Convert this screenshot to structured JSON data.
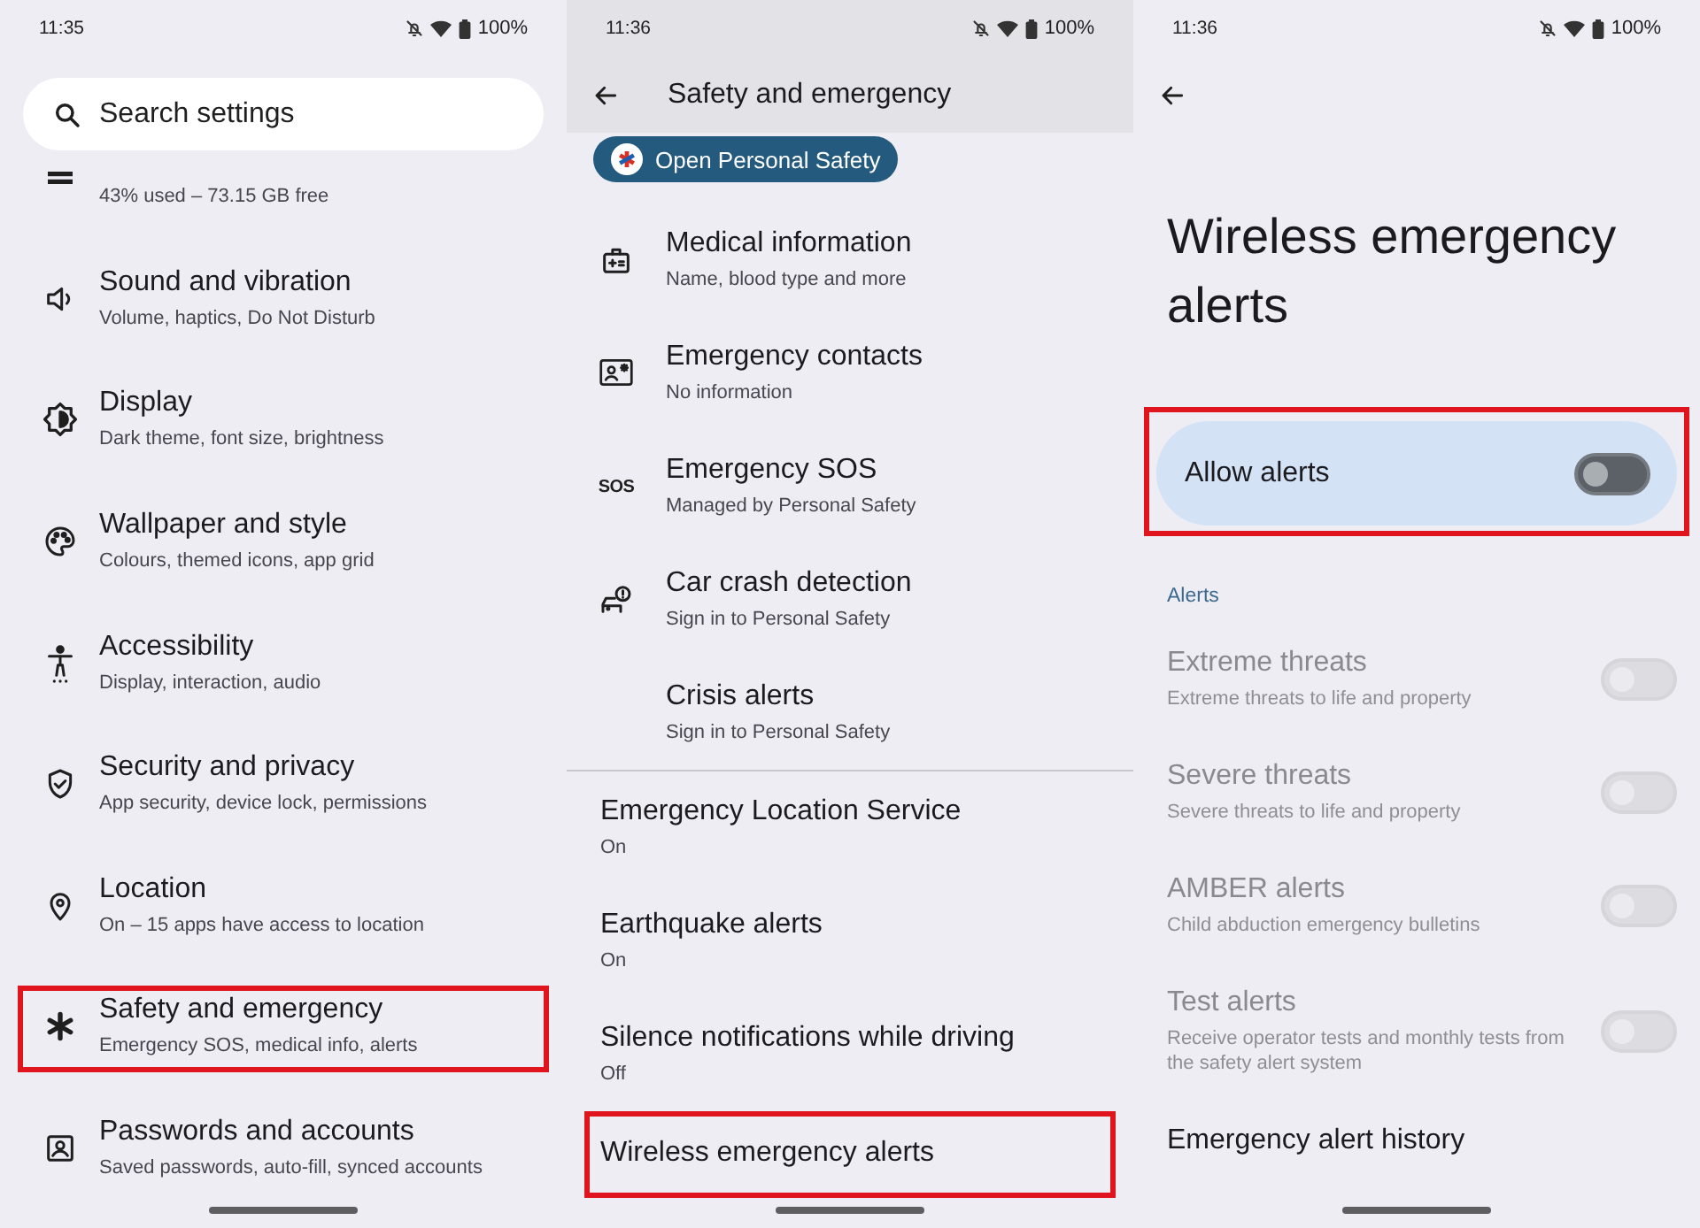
{
  "settings_screen": {
    "status_bar": {
      "time": "11:35",
      "battery": "100%"
    },
    "search": {
      "placeholder": "Search settings"
    },
    "items": [
      {
        "subtitle": "43% used – 73.15 GB free",
        "highlighted": false
      },
      {
        "title": "Sound and vibration",
        "subtitle": "Volume, haptics, Do Not Disturb",
        "highlighted": false
      },
      {
        "title": "Display",
        "subtitle": "Dark theme, font size, brightness",
        "highlighted": false
      },
      {
        "title": "Wallpaper and style",
        "subtitle": "Colours, themed icons, app grid",
        "highlighted": false
      },
      {
        "title": "Accessibility",
        "subtitle": "Display, interaction, audio",
        "highlighted": false
      },
      {
        "title": "Security and privacy",
        "subtitle": "App security, device lock, permissions",
        "highlighted": false
      },
      {
        "title": "Location",
        "subtitle": "On – 15 apps have access to location",
        "highlighted": false
      },
      {
        "title": "Safety and emergency",
        "subtitle": "Emergency SOS, medical info, alerts",
        "highlighted": true
      },
      {
        "title": "Passwords and accounts",
        "subtitle": "Saved passwords, auto-fill, synced accounts",
        "highlighted": false
      }
    ]
  },
  "safety_screen": {
    "status_bar": {
      "time": "11:36",
      "battery": "100%"
    },
    "title": "Safety and emergency",
    "action_button": "Open Personal Safety",
    "features": [
      {
        "title": "Medical information",
        "subtitle": "Name, blood type and more"
      },
      {
        "title": "Emergency contacts",
        "subtitle": "No information"
      },
      {
        "title": "Emergency SOS",
        "subtitle": "Managed by Personal Safety",
        "icon_text": "SOS"
      },
      {
        "title": "Car crash detection",
        "subtitle": "Sign in to Personal Safety"
      },
      {
        "title": "Crisis alerts",
        "subtitle": "Sign in to Personal Safety"
      }
    ],
    "more_items": [
      {
        "title": "Emergency Location Service",
        "subtitle": "On",
        "highlighted": false
      },
      {
        "title": "Earthquake alerts",
        "subtitle": "On",
        "highlighted": false
      },
      {
        "title": "Silence notifications while driving",
        "subtitle": "Off",
        "highlighted": false
      },
      {
        "title": "Wireless emergency alerts",
        "highlighted": true
      }
    ]
  },
  "alerts_screen": {
    "status_bar": {
      "time": "11:36",
      "battery": "100%"
    },
    "title": "Wireless emergency alerts",
    "main_switch": {
      "label": "Allow alerts",
      "on": false,
      "highlighted": true
    },
    "section_header": "Alerts",
    "alerts": [
      {
        "title": "Extreme threats",
        "subtitle": "Extreme threats to life and property",
        "on": false,
        "disabled": true
      },
      {
        "title": "Severe threats",
        "subtitle": "Severe threats to life and property",
        "on": false,
        "disabled": true
      },
      {
        "title": "AMBER alerts",
        "subtitle": "Child abduction emergency bulletins",
        "on": false,
        "disabled": true
      },
      {
        "title": "Test alerts",
        "subtitle": "Receive operator tests and monthly tests from the safety alert system",
        "on": false,
        "disabled": true
      }
    ],
    "history_item": "Emergency alert history"
  }
}
